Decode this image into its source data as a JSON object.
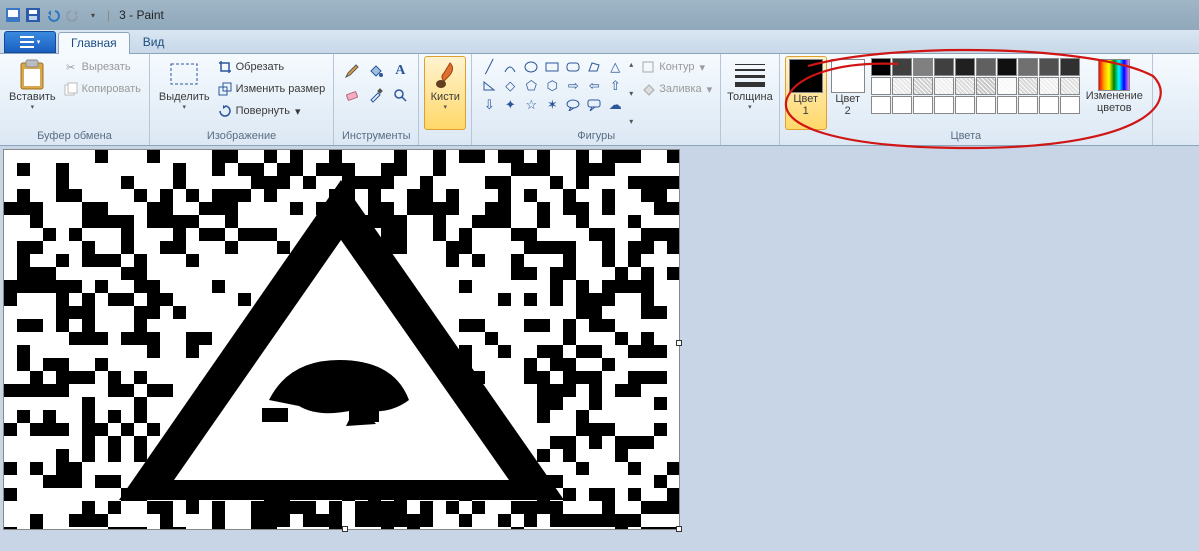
{
  "title_file": "3",
  "title_app": "Paint",
  "tabs": {
    "home": "Главная",
    "view": "Вид"
  },
  "groups": {
    "clipboard": {
      "label": "Буфер обмена",
      "paste": "Вставить",
      "cut": "Вырезать",
      "copy": "Копировать"
    },
    "image": {
      "label": "Изображение",
      "select": "Выделить",
      "crop": "Обрезать",
      "resize": "Изменить размер",
      "rotate": "Повернуть"
    },
    "tools": {
      "label": "Инструменты"
    },
    "brushes": {
      "label": "Кисти"
    },
    "shapes": {
      "label": "Фигуры",
      "outline": "Контур",
      "fill": "Заливка"
    },
    "thickness": {
      "label": "Толщина"
    },
    "colors": {
      "label": "Цвета",
      "c1": "Цвет\n1",
      "c2": "Цвет\n2",
      "edit": "Изменение\nцветов"
    }
  },
  "current_colors": {
    "c1": "#000000",
    "c2": "#ffffff"
  },
  "palette_row1": [
    "#000000",
    "#404040",
    "#808080",
    "#404040",
    "#202020",
    "#606060",
    "#101010",
    "#707070",
    "#505050",
    "#303030"
  ],
  "palette_row2": [
    "#ffffff",
    "#e8e8e8",
    "#d0d0d0",
    "#f0f0f0",
    "#dcdcdc",
    "#c8c8c8",
    "#f8f8f8",
    "#d8d8d8",
    "#efefef",
    "#e0e0e0"
  ],
  "palette_row3": [
    "#ffffff",
    "#ffffff",
    "#ffffff",
    "#ffffff",
    "#ffffff",
    "#ffffff",
    "#ffffff",
    "#ffffff",
    "#ffffff",
    "#ffffff"
  ]
}
